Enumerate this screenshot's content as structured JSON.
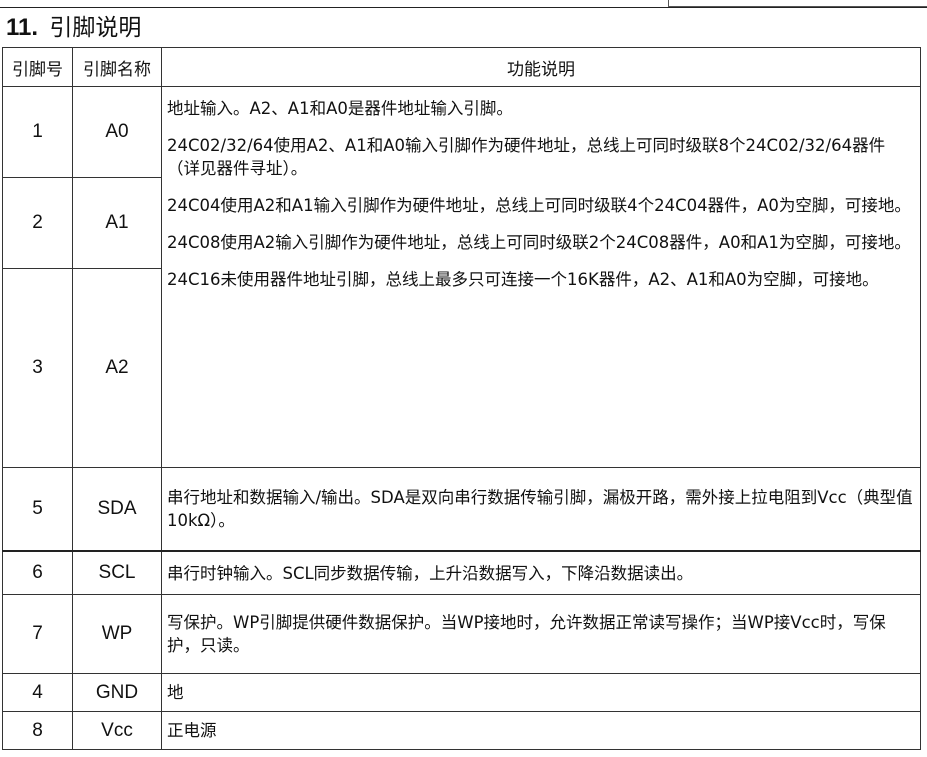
{
  "section": {
    "number": "11.",
    "title": "引脚说明"
  },
  "table": {
    "headers": {
      "pin_no": "引脚号",
      "pin_name": "引脚名称",
      "function": "功能说明"
    },
    "rows": [
      {
        "num": "1",
        "name": "A0"
      },
      {
        "num": "2",
        "name": "A1"
      },
      {
        "num": "3",
        "name": "A2"
      },
      {
        "num": "5",
        "name": "SDA",
        "desc": "串行地址和数据输入/输出。SDA是双向串行数据传输引脚，漏极开路，需外接上拉电阻到Vcc（典型值10kΩ）。"
      },
      {
        "num": "6",
        "name": "SCL",
        "desc": "串行时钟输入。SCL同步数据传输，上升沿数据写入，下降沿数据读出。"
      },
      {
        "num": "7",
        "name": "WP",
        "desc": "写保护。WP引脚提供硬件数据保护。当WP接地时，允许数据正常读写操作；当WP接Vcc时，写保护，只读。"
      },
      {
        "num": "4",
        "name": "GND",
        "desc": "地"
      },
      {
        "num": "8",
        "name": "Vcc",
        "desc": "正电源"
      }
    ],
    "address_pins_desc": [
      "地址输入。A2、A1和A0是器件地址输入引脚。",
      "24C02/32/64使用A2、A1和A0输入引脚作为硬件地址，总线上可同时级联8个24C02/32/64器件（详见器件寻址）。",
      "24C04使用A2和A1输入引脚作为硬件地址，总线上可同时级联4个24C04器件，A0为空脚，可接地。",
      "24C08使用A2输入引脚作为硬件地址，总线上可同时级联2个24C08器件，A0和A1为空脚，可接地。",
      "24C16未使用器件地址引脚，总线上最多只可连接一个16K器件，A2、A1和A0为空脚，可接地。"
    ]
  }
}
